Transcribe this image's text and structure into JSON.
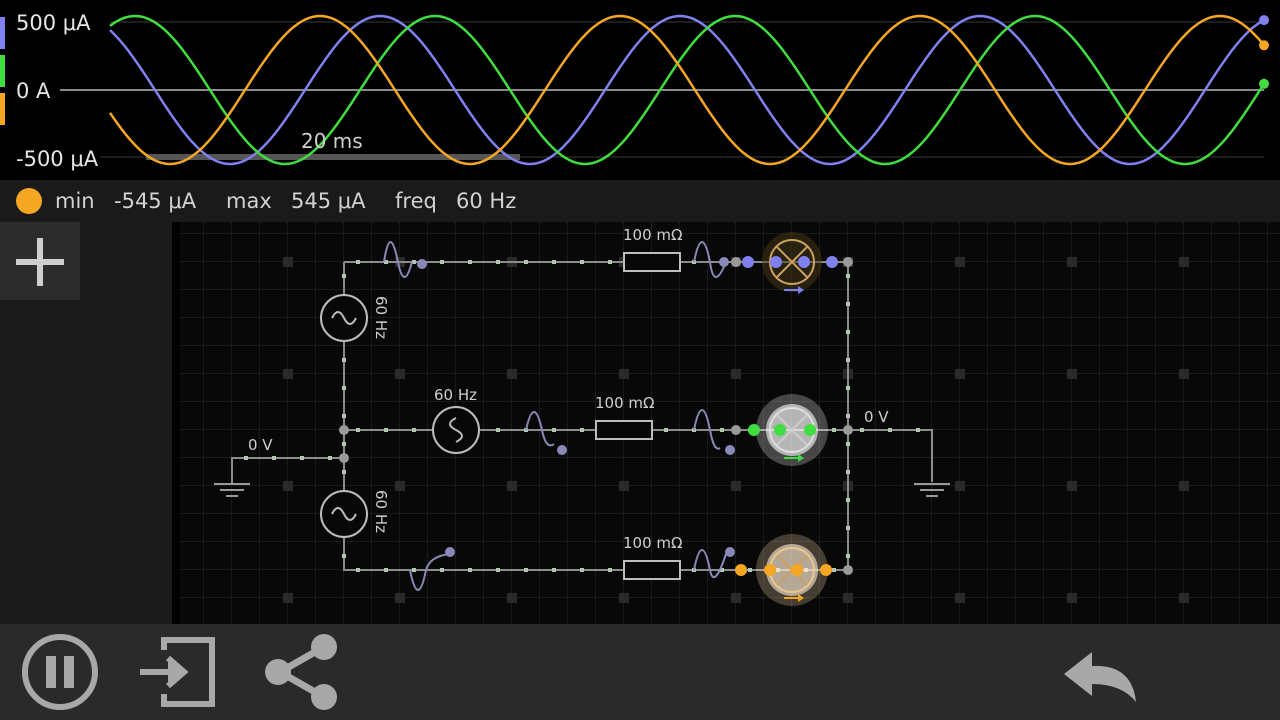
{
  "scope": {
    "y_labels": {
      "max": "500 μA",
      "zero": "0 A",
      "min": "-500 μA"
    },
    "timebase": "20 ms",
    "series_colors": {
      "purple": "#8080f0",
      "green": "#40dd40",
      "orange": "#f5a623"
    }
  },
  "info_bar": {
    "dot_color": "#f5a623",
    "min_label": "min",
    "min_value": "-545 μA",
    "max_label": "max",
    "max_value": "545 μA",
    "freq_label": "freq",
    "freq_value": "60 Hz"
  },
  "circuit": {
    "ground_left_label": "0 V",
    "ground_right_label": "0 V",
    "source_top_label": "60 Hz",
    "source_mid_label": "60 Hz",
    "source_bottom_label": "60 Hz",
    "resistor_top_label": "100 mΩ",
    "resistor_mid_label": "100 mΩ",
    "resistor_bottom_label": "100 mΩ"
  },
  "toolbar": {
    "add_icon": "plus-icon",
    "pause_icon": "pause-icon",
    "import_icon": "import-icon",
    "share_icon": "share-icon",
    "undo_icon": "undo-icon"
  }
}
